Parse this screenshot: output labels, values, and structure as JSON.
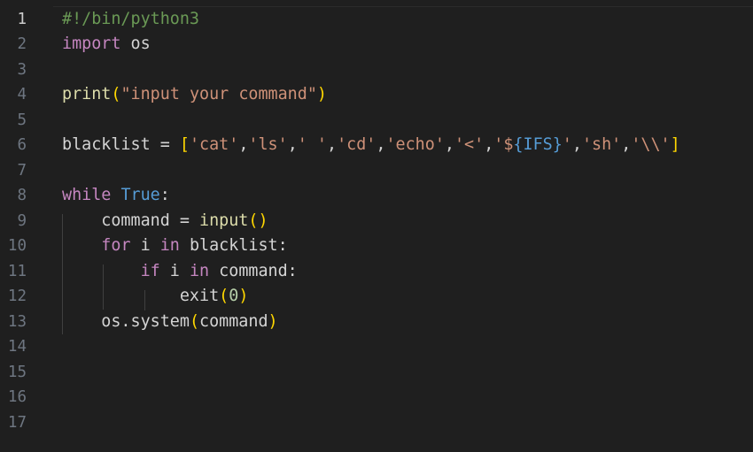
{
  "editor": {
    "line_numbers": [
      "1",
      "2",
      "3",
      "4",
      "5",
      "6",
      "7",
      "8",
      "9",
      "10",
      "11",
      "12",
      "13",
      "14",
      "15",
      "16",
      "17"
    ],
    "active_line": "1",
    "lines": [
      [
        {
          "t": "#!/bin/python3",
          "c": "comment"
        }
      ],
      [
        {
          "t": "import",
          "c": "keyword"
        },
        {
          "t": " os",
          "c": "plain"
        }
      ],
      [],
      [
        {
          "t": "print",
          "c": "func"
        },
        {
          "t": "(",
          "c": "brk1"
        },
        {
          "t": "\"input your command\"",
          "c": "string"
        },
        {
          "t": ")",
          "c": "brk1"
        }
      ],
      [],
      [
        {
          "t": "blacklist = ",
          "c": "plain"
        },
        {
          "t": "[",
          "c": "brk1"
        },
        {
          "t": "'cat'",
          "c": "string"
        },
        {
          "t": ",",
          "c": "plain"
        },
        {
          "t": "'ls'",
          "c": "string"
        },
        {
          "t": ",",
          "c": "plain"
        },
        {
          "t": "' '",
          "c": "string"
        },
        {
          "t": ",",
          "c": "plain"
        },
        {
          "t": "'cd'",
          "c": "string"
        },
        {
          "t": ",",
          "c": "plain"
        },
        {
          "t": "'echo'",
          "c": "string"
        },
        {
          "t": ",",
          "c": "plain"
        },
        {
          "t": "'<'",
          "c": "string"
        },
        {
          "t": ",",
          "c": "plain"
        },
        {
          "t": "'$",
          "c": "string"
        },
        {
          "t": "{IFS}",
          "c": "const"
        },
        {
          "t": "'",
          "c": "string"
        },
        {
          "t": ",",
          "c": "plain"
        },
        {
          "t": "'sh'",
          "c": "string"
        },
        {
          "t": ",",
          "c": "plain"
        },
        {
          "t": "'\\\\'",
          "c": "string"
        },
        {
          "t": "]",
          "c": "brk1"
        }
      ],
      [],
      [
        {
          "t": "while",
          "c": "keyword"
        },
        {
          "t": " ",
          "c": "plain"
        },
        {
          "t": "True",
          "c": "const"
        },
        {
          "t": ":",
          "c": "plain"
        }
      ],
      [
        {
          "t": "    command = ",
          "c": "plain"
        },
        {
          "t": "input",
          "c": "func"
        },
        {
          "t": "()",
          "c": "brk1"
        }
      ],
      [
        {
          "t": "    ",
          "c": "plain"
        },
        {
          "t": "for",
          "c": "keyword"
        },
        {
          "t": " i ",
          "c": "plain"
        },
        {
          "t": "in",
          "c": "keyword"
        },
        {
          "t": " blacklist:",
          "c": "plain"
        }
      ],
      [
        {
          "t": "        ",
          "c": "plain"
        },
        {
          "t": "if",
          "c": "keyword"
        },
        {
          "t": " i ",
          "c": "plain"
        },
        {
          "t": "in",
          "c": "keyword"
        },
        {
          "t": " command:",
          "c": "plain"
        }
      ],
      [
        {
          "t": "            exit",
          "c": "plain"
        },
        {
          "t": "(",
          "c": "brk1"
        },
        {
          "t": "0",
          "c": "number"
        },
        {
          "t": ")",
          "c": "brk1"
        }
      ],
      [
        {
          "t": "    os.system",
          "c": "plain"
        },
        {
          "t": "(",
          "c": "brk1"
        },
        {
          "t": "command",
          "c": "plain"
        },
        {
          "t": ")",
          "c": "brk1"
        }
      ],
      [],
      [],
      [],
      []
    ]
  }
}
